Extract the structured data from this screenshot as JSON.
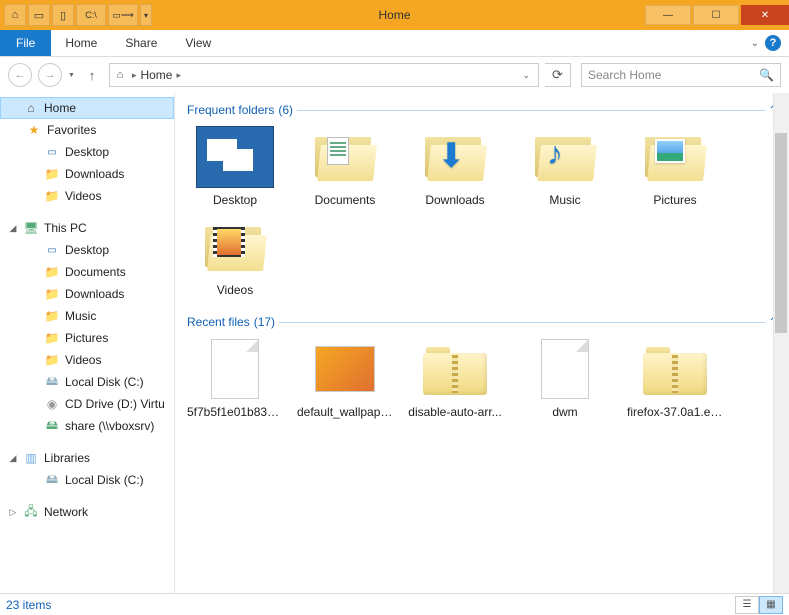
{
  "window": {
    "title": "Home"
  },
  "ribbon": {
    "file": "File",
    "tabs": [
      "Home",
      "Share",
      "View"
    ]
  },
  "address": {
    "location": "Home",
    "search_placeholder": "Search Home"
  },
  "nav_tree": {
    "home": "Home",
    "favorites": "Favorites",
    "fav_items": [
      "Desktop",
      "Downloads",
      "Videos"
    ],
    "this_pc": "This PC",
    "pc_items": [
      "Desktop",
      "Documents",
      "Downloads",
      "Music",
      "Pictures",
      "Videos",
      "Local Disk (C:)",
      "CD Drive (D:) Virtu",
      "share (\\\\vboxsrv)"
    ],
    "libraries": "Libraries",
    "lib_items": [
      "Local Disk (C:)"
    ],
    "network": "Network"
  },
  "sections": {
    "frequent": {
      "title": "Frequent folders",
      "count": "(6)"
    },
    "recent": {
      "title": "Recent files",
      "count": "(17)"
    }
  },
  "frequent_items": [
    {
      "label": "Desktop",
      "kind": "desktop"
    },
    {
      "label": "Documents",
      "kind": "documents"
    },
    {
      "label": "Downloads",
      "kind": "downloads"
    },
    {
      "label": "Music",
      "kind": "music"
    },
    {
      "label": "Pictures",
      "kind": "pictures"
    },
    {
      "label": "Videos",
      "kind": "videos"
    }
  ],
  "recent_items": [
    {
      "label": "5f7b5f1e01b8376...",
      "kind": "file"
    },
    {
      "label": "default_wallpape...",
      "kind": "image"
    },
    {
      "label": "disable-auto-arr...",
      "kind": "zip"
    },
    {
      "label": "dwm",
      "kind": "file"
    },
    {
      "label": "firefox-37.0a1.en...",
      "kind": "zip"
    }
  ],
  "status": {
    "items": "23 items"
  }
}
